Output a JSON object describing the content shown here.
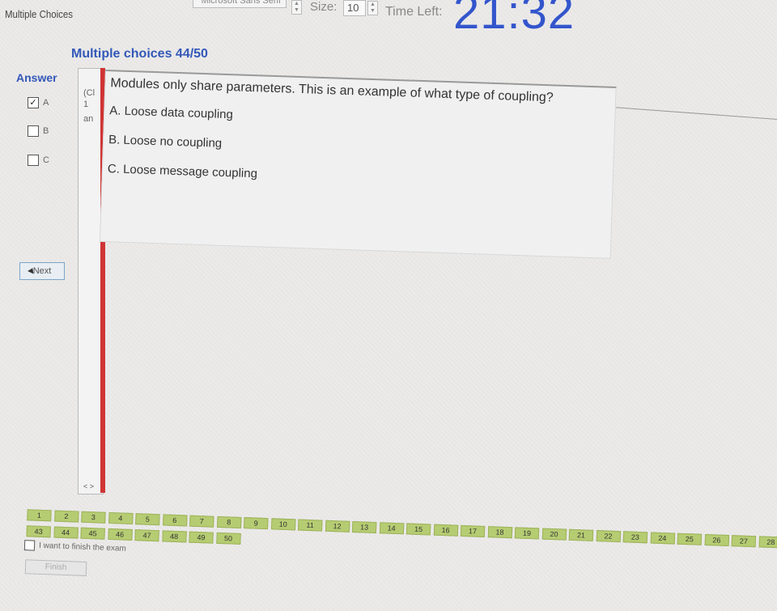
{
  "window": {
    "title": "Multiple Choices"
  },
  "toolbar": {
    "font_value": "Microsoft Sans Serif",
    "size_label": "Size:",
    "size_value": "10",
    "time_label": "Time Left:",
    "timer": "21:32"
  },
  "section": {
    "title": "Multiple choices 44/50"
  },
  "answer": {
    "heading": "Answer",
    "options": [
      {
        "label": "A",
        "checked": true
      },
      {
        "label": "B",
        "checked": false
      },
      {
        "label": "C",
        "checked": false
      }
    ]
  },
  "next_button": "Next",
  "left_snippet": [
    "(Cl",
    "1",
    "an"
  ],
  "left_scroll_arrows": "< >",
  "question": {
    "text": "Modules only share parameters. This is an example of what type of coupling?",
    "options": [
      "A. Loose data coupling",
      "B. Loose no coupling",
      "C. Loose message coupling"
    ]
  },
  "nav": {
    "row1": [
      "1",
      "2",
      "3",
      "4",
      "5",
      "6",
      "7",
      "8",
      "9",
      "10",
      "11",
      "12",
      "13",
      "14",
      "15",
      "16",
      "17",
      "18",
      "19",
      "20",
      "21",
      "22",
      "23",
      "24",
      "25",
      "26",
      "27",
      "28"
    ],
    "row2": [
      "43",
      "44",
      "45",
      "46",
      "47",
      "48",
      "49",
      "50"
    ],
    "finish_checkbox_label": "I want to finish the exam",
    "finish_button": "Finish"
  },
  "colors": {
    "accent_blue": "#3358b8",
    "timer_blue": "#3355cc",
    "red_bar": "#d03434",
    "nav_green": "#b6cc72"
  }
}
